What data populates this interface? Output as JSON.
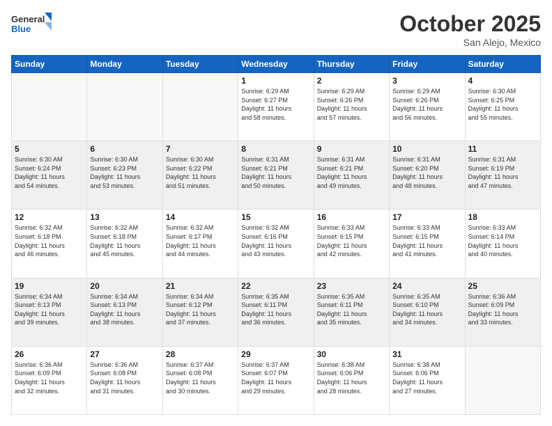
{
  "logo": {
    "line1": "General",
    "line2": "Blue"
  },
  "header": {
    "month": "October 2025",
    "location": "San Alejo, Mexico"
  },
  "weekdays": [
    "Sunday",
    "Monday",
    "Tuesday",
    "Wednesday",
    "Thursday",
    "Friday",
    "Saturday"
  ],
  "weeks": [
    [
      {
        "day": "",
        "info": ""
      },
      {
        "day": "",
        "info": ""
      },
      {
        "day": "",
        "info": ""
      },
      {
        "day": "1",
        "info": "Sunrise: 6:29 AM\nSunset: 6:27 PM\nDaylight: 11 hours\nand 58 minutes."
      },
      {
        "day": "2",
        "info": "Sunrise: 6:29 AM\nSunset: 6:26 PM\nDaylight: 11 hours\nand 57 minutes."
      },
      {
        "day": "3",
        "info": "Sunrise: 6:29 AM\nSunset: 6:26 PM\nDaylight: 11 hours\nand 56 minutes."
      },
      {
        "day": "4",
        "info": "Sunrise: 6:30 AM\nSunset: 6:25 PM\nDaylight: 11 hours\nand 55 minutes."
      }
    ],
    [
      {
        "day": "5",
        "info": "Sunrise: 6:30 AM\nSunset: 6:24 PM\nDaylight: 11 hours\nand 54 minutes."
      },
      {
        "day": "6",
        "info": "Sunrise: 6:30 AM\nSunset: 6:23 PM\nDaylight: 11 hours\nand 53 minutes."
      },
      {
        "day": "7",
        "info": "Sunrise: 6:30 AM\nSunset: 6:22 PM\nDaylight: 11 hours\nand 51 minutes."
      },
      {
        "day": "8",
        "info": "Sunrise: 6:31 AM\nSunset: 6:21 PM\nDaylight: 11 hours\nand 50 minutes."
      },
      {
        "day": "9",
        "info": "Sunrise: 6:31 AM\nSunset: 6:21 PM\nDaylight: 11 hours\nand 49 minutes."
      },
      {
        "day": "10",
        "info": "Sunrise: 6:31 AM\nSunset: 6:20 PM\nDaylight: 11 hours\nand 48 minutes."
      },
      {
        "day": "11",
        "info": "Sunrise: 6:31 AM\nSunset: 6:19 PM\nDaylight: 11 hours\nand 47 minutes."
      }
    ],
    [
      {
        "day": "12",
        "info": "Sunrise: 6:32 AM\nSunset: 6:18 PM\nDaylight: 11 hours\nand 46 minutes."
      },
      {
        "day": "13",
        "info": "Sunrise: 6:32 AM\nSunset: 6:18 PM\nDaylight: 11 hours\nand 45 minutes."
      },
      {
        "day": "14",
        "info": "Sunrise: 6:32 AM\nSunset: 6:17 PM\nDaylight: 11 hours\nand 44 minutes."
      },
      {
        "day": "15",
        "info": "Sunrise: 6:32 AM\nSunset: 6:16 PM\nDaylight: 11 hours\nand 43 minutes."
      },
      {
        "day": "16",
        "info": "Sunrise: 6:33 AM\nSunset: 6:15 PM\nDaylight: 11 hours\nand 42 minutes."
      },
      {
        "day": "17",
        "info": "Sunrise: 6:33 AM\nSunset: 6:15 PM\nDaylight: 11 hours\nand 41 minutes."
      },
      {
        "day": "18",
        "info": "Sunrise: 6:33 AM\nSunset: 6:14 PM\nDaylight: 11 hours\nand 40 minutes."
      }
    ],
    [
      {
        "day": "19",
        "info": "Sunrise: 6:34 AM\nSunset: 6:13 PM\nDaylight: 11 hours\nand 39 minutes."
      },
      {
        "day": "20",
        "info": "Sunrise: 6:34 AM\nSunset: 6:13 PM\nDaylight: 11 hours\nand 38 minutes."
      },
      {
        "day": "21",
        "info": "Sunrise: 6:34 AM\nSunset: 6:12 PM\nDaylight: 11 hours\nand 37 minutes."
      },
      {
        "day": "22",
        "info": "Sunrise: 6:35 AM\nSunset: 6:11 PM\nDaylight: 11 hours\nand 36 minutes."
      },
      {
        "day": "23",
        "info": "Sunrise: 6:35 AM\nSunset: 6:11 PM\nDaylight: 11 hours\nand 35 minutes."
      },
      {
        "day": "24",
        "info": "Sunrise: 6:35 AM\nSunset: 6:10 PM\nDaylight: 11 hours\nand 34 minutes."
      },
      {
        "day": "25",
        "info": "Sunrise: 6:36 AM\nSunset: 6:09 PM\nDaylight: 11 hours\nand 33 minutes."
      }
    ],
    [
      {
        "day": "26",
        "info": "Sunrise: 6:36 AM\nSunset: 6:09 PM\nDaylight: 11 hours\nand 32 minutes."
      },
      {
        "day": "27",
        "info": "Sunrise: 6:36 AM\nSunset: 6:08 PM\nDaylight: 11 hours\nand 31 minutes."
      },
      {
        "day": "28",
        "info": "Sunrise: 6:37 AM\nSunset: 6:08 PM\nDaylight: 11 hours\nand 30 minutes."
      },
      {
        "day": "29",
        "info": "Sunrise: 6:37 AM\nSunset: 6:07 PM\nDaylight: 11 hours\nand 29 minutes."
      },
      {
        "day": "30",
        "info": "Sunrise: 6:38 AM\nSunset: 6:06 PM\nDaylight: 11 hours\nand 28 minutes."
      },
      {
        "day": "31",
        "info": "Sunrise: 6:38 AM\nSunset: 6:06 PM\nDaylight: 11 hours\nand 27 minutes."
      },
      {
        "day": "",
        "info": ""
      }
    ]
  ]
}
